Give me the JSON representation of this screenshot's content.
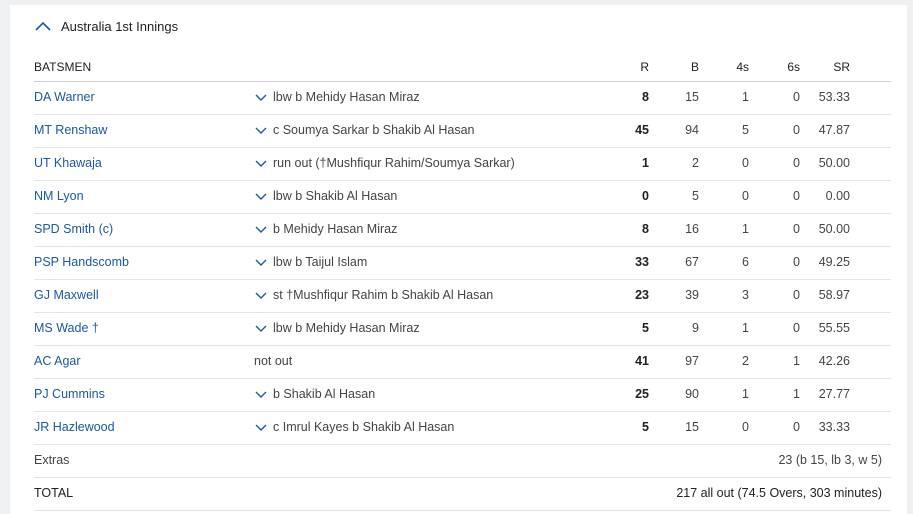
{
  "innings": {
    "title": "Australia 1st Innings",
    "icon": "chevron-up-icon",
    "accent": "#1b58a5"
  },
  "columns": {
    "batsmen": "BATSMEN",
    "r": "R",
    "b": "B",
    "fours": "4s",
    "sixes": "6s",
    "sr": "SR"
  },
  "batsmen": [
    {
      "name": "DA Warner",
      "dismissal": "lbw b Mehidy Hasan Miraz",
      "has_chevron": true,
      "r": "8",
      "b": "15",
      "fours": "1",
      "sixes": "0",
      "sr": "53.33"
    },
    {
      "name": "MT Renshaw",
      "dismissal": "c Soumya Sarkar b Shakib Al Hasan",
      "has_chevron": true,
      "r": "45",
      "b": "94",
      "fours": "5",
      "sixes": "0",
      "sr": "47.87"
    },
    {
      "name": "UT Khawaja",
      "dismissal": "run out (†Mushfiqur Rahim/Soumya Sarkar)",
      "has_chevron": true,
      "r": "1",
      "b": "2",
      "fours": "0",
      "sixes": "0",
      "sr": "50.00"
    },
    {
      "name": "NM Lyon",
      "dismissal": "lbw b Shakib Al Hasan",
      "has_chevron": true,
      "r": "0",
      "b": "5",
      "fours": "0",
      "sixes": "0",
      "sr": "0.00"
    },
    {
      "name": "SPD Smith (c)",
      "dismissal": "b Mehidy Hasan Miraz",
      "has_chevron": true,
      "r": "8",
      "b": "16",
      "fours": "1",
      "sixes": "0",
      "sr": "50.00"
    },
    {
      "name": "PSP Handscomb",
      "dismissal": "lbw b Taijul Islam",
      "has_chevron": true,
      "r": "33",
      "b": "67",
      "fours": "6",
      "sixes": "0",
      "sr": "49.25"
    },
    {
      "name": "GJ Maxwell",
      "dismissal": "st †Mushfiqur Rahim b Shakib Al Hasan",
      "has_chevron": true,
      "r": "23",
      "b": "39",
      "fours": "3",
      "sixes": "0",
      "sr": "58.97"
    },
    {
      "name": "MS Wade †",
      "dismissal": "lbw b Mehidy Hasan Miraz",
      "has_chevron": true,
      "r": "5",
      "b": "9",
      "fours": "1",
      "sixes": "0",
      "sr": "55.55"
    },
    {
      "name": "AC Agar",
      "dismissal": "not out",
      "has_chevron": false,
      "r": "41",
      "b": "97",
      "fours": "2",
      "sixes": "1",
      "sr": "42.26"
    },
    {
      "name": "PJ Cummins",
      "dismissal": "b Shakib Al Hasan",
      "has_chevron": true,
      "r": "25",
      "b": "90",
      "fours": "1",
      "sixes": "1",
      "sr": "27.77"
    },
    {
      "name": "JR Hazlewood",
      "dismissal": "c Imrul Kayes b Shakib Al Hasan",
      "has_chevron": true,
      "r": "5",
      "b": "15",
      "fours": "0",
      "sixes": "0",
      "sr": "33.33"
    }
  ],
  "extras": {
    "label": "Extras",
    "value": "23 (b 15, lb 3, w 5)"
  },
  "total": {
    "label": "TOTAL",
    "value": "217 all out (74.5 Overs, 303 minutes)"
  }
}
